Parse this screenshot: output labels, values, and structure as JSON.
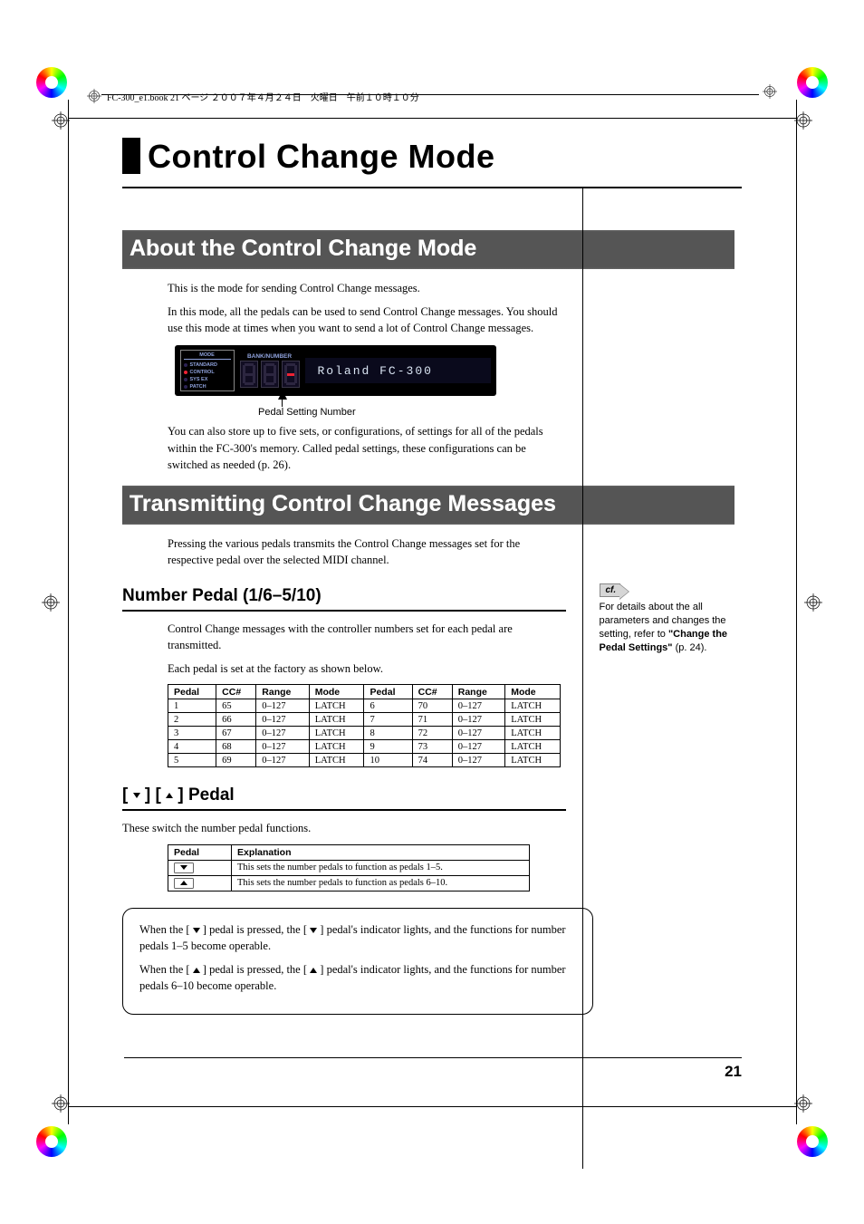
{
  "header_line": "FC-300_e1.book  21 ページ  ２００７年４月２４日　火曜日　午前１０時１０分",
  "chapter_title": "Control Change Mode",
  "section1_title": "About the Control Change Mode",
  "section1_p1": "This is the mode for sending Control Change messages.",
  "section1_p2": "In this mode, all the pedals can be used to send Control Change messages. You should use this mode at times when you want to send a lot of Control Change messages.",
  "device": {
    "mode_header": "MODE",
    "mode_items": [
      "STANDARD",
      "CONTROL",
      "SYS EX",
      "PATCH"
    ],
    "bank_label": "BANK/NUMBER",
    "lcd_text": "Roland  FC-300"
  },
  "caption1": "Pedal Setting Number",
  "section1_p3": "You can also store up to five sets, or configurations, of settings for all of the pedals within the FC-300's memory. Called pedal settings, these configurations can be switched as needed (p. 26).",
  "section2_title": "Transmitting Control Change Messages",
  "section2_p1": "Pressing the various pedals transmits the Control Change messages set for the respective pedal over the selected MIDI channel.",
  "sub1_title": "Number Pedal (1/6–5/10)",
  "sub1_p1": "Control Change messages with the controller numbers set for each pedal are transmitted.",
  "sub1_p2": "Each pedal is set at the factory as shown below.",
  "table1_headers": [
    "Pedal",
    "CC#",
    "Range",
    "Mode",
    "Pedal",
    "CC#",
    "Range",
    "Mode"
  ],
  "table1_rows": [
    [
      "1",
      "65",
      "0–127",
      "LATCH",
      "6",
      "70",
      "0–127",
      "LATCH"
    ],
    [
      "2",
      "66",
      "0–127",
      "LATCH",
      "7",
      "71",
      "0–127",
      "LATCH"
    ],
    [
      "3",
      "67",
      "0–127",
      "LATCH",
      "8",
      "72",
      "0–127",
      "LATCH"
    ],
    [
      "4",
      "68",
      "0–127",
      "LATCH",
      "9",
      "73",
      "0–127",
      "LATCH"
    ],
    [
      "5",
      "69",
      "0–127",
      "LATCH",
      "10",
      "74",
      "0–127",
      "LATCH"
    ]
  ],
  "sub2_title_pre": "[ ",
  "sub2_title_mid": " ] [ ",
  "sub2_title_post": " ] Pedal",
  "sub2_p1": "These switch the number pedal functions.",
  "table2_headers": [
    "Pedal",
    "Explanation"
  ],
  "table2_rows": [
    {
      "exp": "This sets the number pedals to function as pedals 1–5."
    },
    {
      "exp": "This sets the number pedals to function as pedals 6–10."
    }
  ],
  "note_p1_a": "When the [ ",
  "note_p1_b": " ] pedal is pressed, the [ ",
  "note_p1_c": " ] pedal's indicator lights, and the functions for number pedals 1–5 become operable.",
  "note_p2_a": "When the [ ",
  "note_p2_b": " ] pedal is pressed, the [ ",
  "note_p2_c": " ] pedal's indicator lights, and the functions for number pedals 6–10 become operable.",
  "cf_label": "cf.",
  "side_p1": "For details about the all parameters and changes the setting, refer to ",
  "side_bold": "\"Change the Pedal Settings\"",
  "side_p2": " (p. 24).",
  "page_number": "21"
}
